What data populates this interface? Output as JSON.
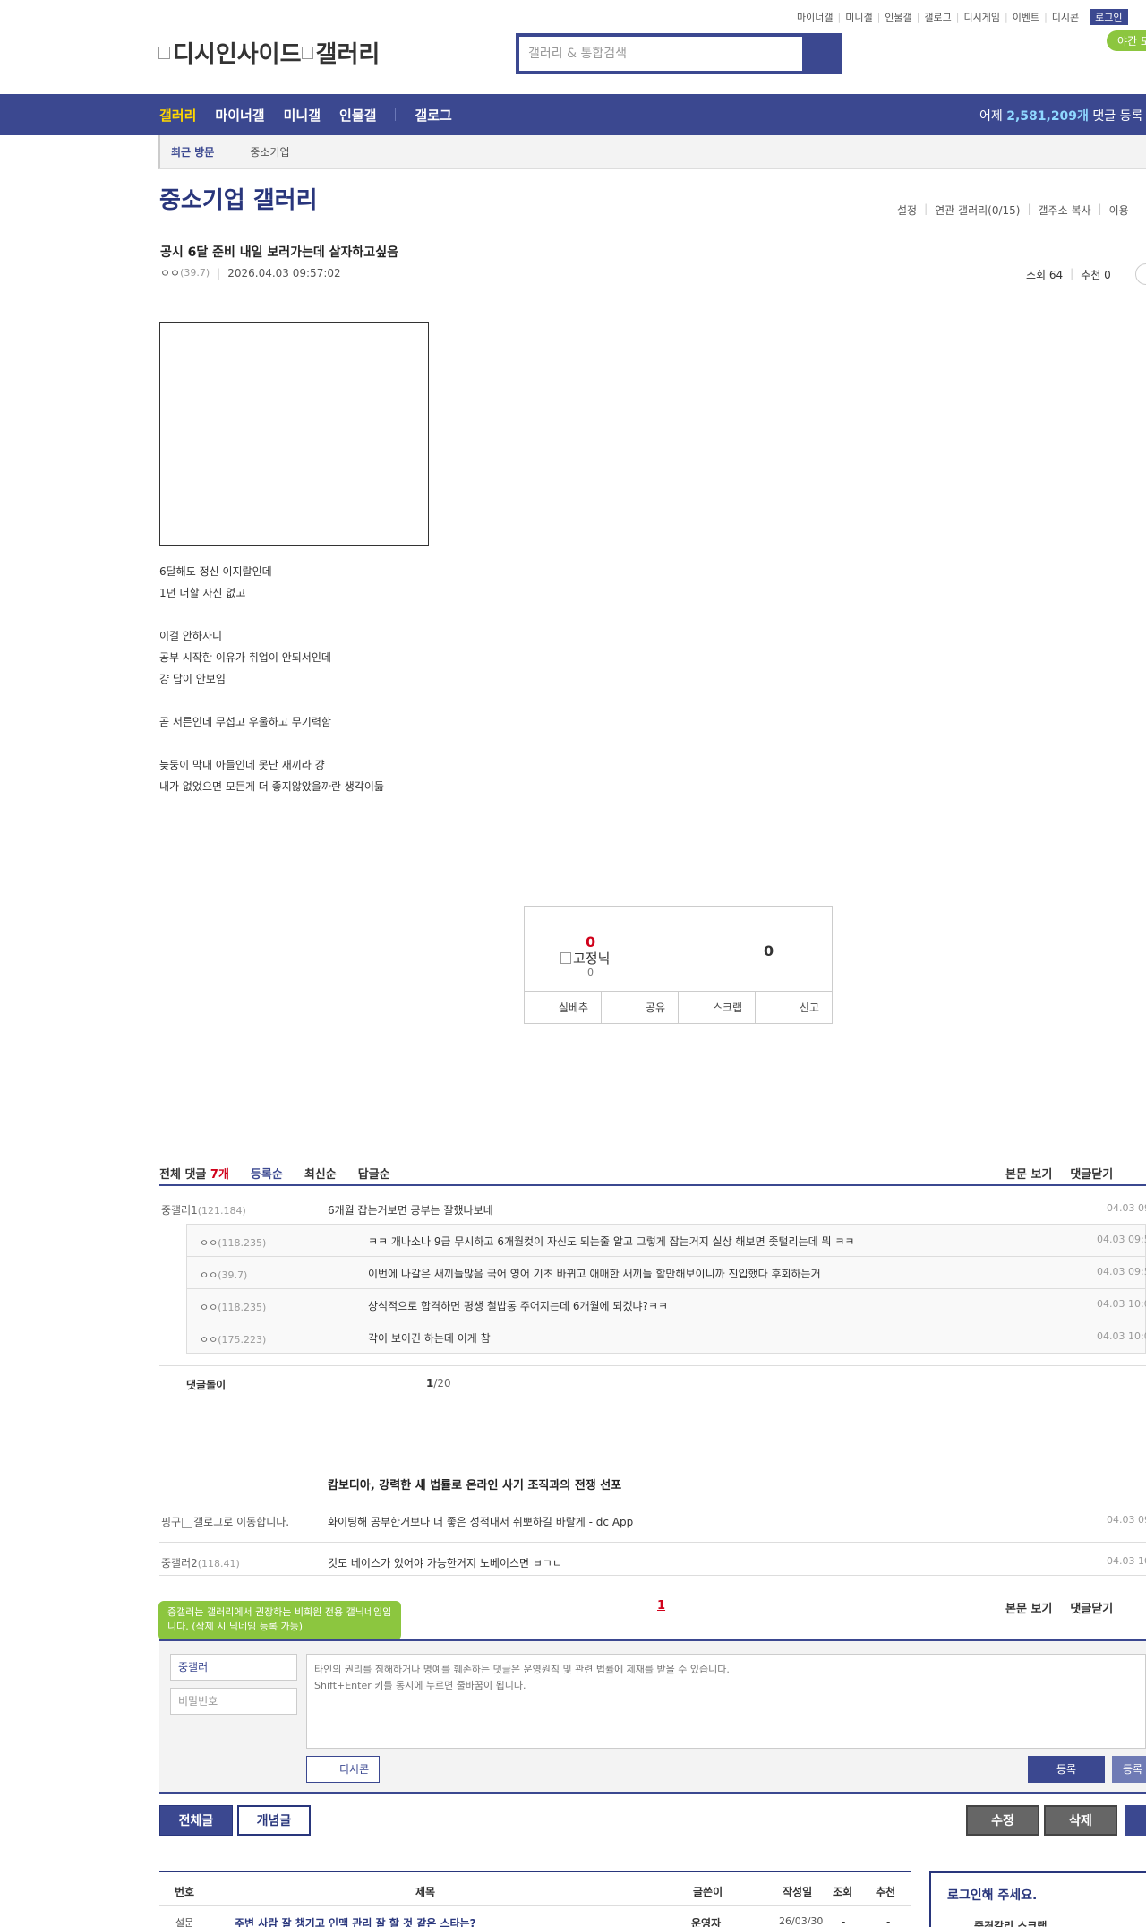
{
  "header": {
    "top_links": [
      "마이너갤",
      "미니갤",
      "인물갤",
      "갤로그",
      "디시게임",
      "이벤트",
      "디시콘"
    ],
    "login": "로그인",
    "night_mode": "야간 모",
    "logo_text_1": "디시인사이드",
    "logo_text_2": "갤러리",
    "search_placeholder": "갤러리 & 통합검색"
  },
  "gnb": {
    "items": [
      "갤러리",
      "마이너갤",
      "미니갤",
      "인물갤",
      "갤로그"
    ],
    "stat_prefix": "어제",
    "stat_value": "2,581,209개",
    "stat_suffix": "댓글 등록"
  },
  "recent": {
    "label": "최근 방문",
    "items": [
      "중소기업"
    ]
  },
  "gallery": {
    "title": "중소기업 갤러리",
    "tools": [
      "설정",
      "연관 갤러리(0/15)",
      "갤주소 복사",
      "이용"
    ]
  },
  "post": {
    "title": "공시 6달 준비 내일 보러가는데 살자하고싶음",
    "author": "ㅇㅇ",
    "author_ip": "(39.7)",
    "datetime": "2026.04.03 09:57:02",
    "views": "조회 64",
    "recommend": "추천 0",
    "body": [
      "6달해도 정신 이지랄인데",
      "1년 더할 자신 없고",
      "",
      "이걸 안하자니",
      "공부 시작한 이유가 취업이 안되서인데",
      "걍 답이 안보임",
      "",
      "곧 서른인데 무섭고 우울하고 무기력함",
      "",
      "늦둥이 막내 아들인데 못난 새끼라 걍",
      "내가 없었으면 모든게 더 좋지않았을까란 생각이듦"
    ]
  },
  "vote": {
    "up": "0",
    "fixed_nick_img": "고정닉",
    "fixed_count": "0",
    "down": "0",
    "buttons": [
      "실베추",
      "공유",
      "스크랩",
      "신고"
    ]
  },
  "comments": {
    "total_label": "전체 댓글",
    "total_count": "7개",
    "sort": [
      "등록순",
      "최신순",
      "답글순"
    ],
    "tools": [
      "본문 보기",
      "댓글닫기"
    ],
    "top": {
      "nick": "중갤러1",
      "ip": "(121.184)",
      "text": "6개월 잡는거보면 공부는 잘했나보네",
      "date": "04.03 09"
    },
    "replies": [
      {
        "nick": "ㅇㅇ",
        "ip": "(118.235)",
        "text": "ㅋㅋ 개나소나 9급 무시하고 6개월컷이 자신도 되는줄 알고 그렇게 잡는거지 실상 해보면 좆털리는데 뭐 ㅋㅋ",
        "date": "04.03 09:5"
      },
      {
        "nick": "ㅇㅇ",
        "ip": "(39.7)",
        "text": "이번에 나갈은 새끼들많음 국어 영어 기초 바뀌고 애매한 새끼들 할만해보이니까 진입했다 후회하는거",
        "date": "04.03 09:5"
      },
      {
        "nick": "ㅇㅇ",
        "ip": "(118.235)",
        "text": "상식적으로 합격하면 평생 철밥통 주어지는데 6개월에 되겠냐?ㅋㅋ",
        "date": "04.03 10:0"
      },
      {
        "nick": "ㅇㅇ",
        "ip": "(175.223)",
        "text": "각이 보이긴 하는데 이게 참",
        "date": "04.03 10:0"
      }
    ],
    "bot_label": "댓글돌이",
    "bot_page_current": "1",
    "bot_page_total": "/20",
    "news_title": "캄보디아, 강력한 새 법률로 온라인 사기 조직과의 전쟁 선포",
    "others": [
      {
        "nick": "핑구",
        "img_alt": "갤로그로 이동합니다.",
        "text": "화이팅해 공부한거보다 더 좋은 성적내서 취뽀하길 바랄게 - dc App",
        "date": "04.03 09"
      },
      {
        "nick": "중갤러2",
        "ip": "(118.41)",
        "text": "것도 베이스가 있어야 가능한거지 노베이스면 ㅂㄱㄴ",
        "date": "04.03 10"
      }
    ],
    "page_current": "1"
  },
  "write": {
    "tooltip": "중갤러는 갤러리에서 권장하는 비회원 전용 갤닉네임입니다. (삭제 시 닉네임 등록 가능)",
    "nick_value": "중갤러",
    "password_placeholder": "비밀번호",
    "textarea_placeholder": "타인의 권리를 침해하거나 명예를 훼손하는 댓글은 운영원칙 및 관련 법률에 제재를 받을 수 있습니다.\nShift+Enter 키를 동시에 누르면 줄바꿈이 됩니다.",
    "dccon": "디시콘",
    "submit": "등록",
    "submit2": "등록"
  },
  "bottom_buttons": {
    "all": "전체글",
    "best": "개념글",
    "edit": "수정",
    "delete": "삭제"
  },
  "list": {
    "headers": [
      "번호",
      "제목",
      "글쓴이",
      "작성일",
      "조회",
      "추천"
    ],
    "rows": [
      {
        "no": "설문",
        "title": "주변 사람 잘 챙기고 인맥 관리 잘 할 것 같은 스타는?",
        "writer": "운영자",
        "date": "26/03/30",
        "views": "-",
        "rec": "-"
      }
    ]
  },
  "login_box": {
    "title": "로그인해 주세요.",
    "sub": "중경갈리   스크랩"
  },
  "colors": {
    "brand": "#3b4890",
    "accent": "#8cc63f",
    "active": "#ffd600"
  }
}
